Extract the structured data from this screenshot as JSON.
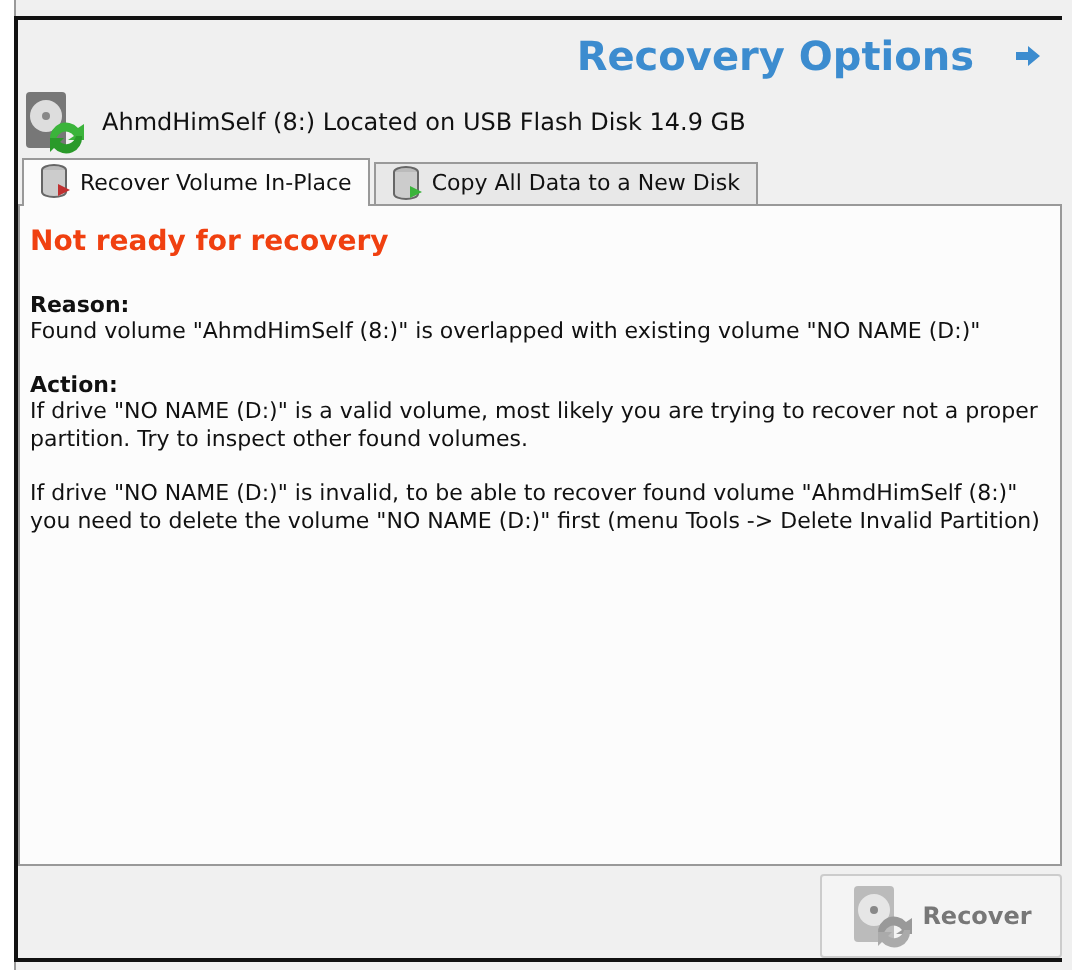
{
  "window": {
    "title": "Recovery Options"
  },
  "volume": {
    "label": "AhmdHimSelf (8:) Located on USB Flash Disk 14.9 GB"
  },
  "tabs": [
    {
      "label": "Recover Volume In-Place",
      "selected": true
    },
    {
      "label": "Copy All Data to a New Disk",
      "selected": false
    }
  ],
  "status": {
    "heading": "Not ready for recovery"
  },
  "sections": [
    {
      "heading": "Reason:",
      "paragraphs": [
        "Found volume \"AhmdHimSelf (8:)\" is overlapped with existing volume \"NO NAME (D:)\""
      ]
    },
    {
      "heading": "Action:",
      "paragraphs": [
        "If drive \"NO NAME (D:)\" is a valid volume, most likely you are trying to recover not a proper partition. Try to inspect other found volumes.",
        "If drive \"NO NAME (D:)\" is invalid, to be able to recover found volume \"AhmdHimSelf (8:)\" you need to delete the volume \"NO NAME (D:)\" first (menu Tools -> Delete Invalid Partition)"
      ]
    }
  ],
  "recover_button": {
    "label": "Recover",
    "disabled": true
  }
}
